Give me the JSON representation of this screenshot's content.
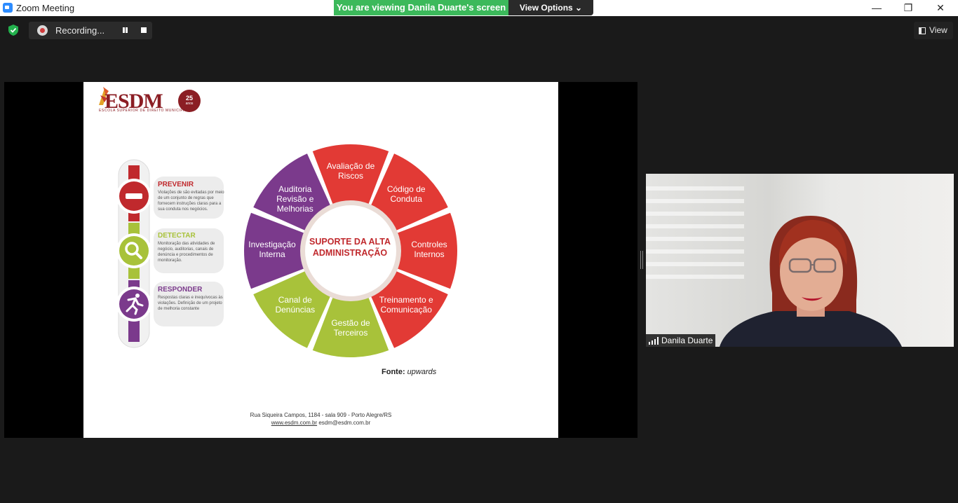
{
  "window": {
    "title": "Zoom Meeting",
    "minimize": "—",
    "restore": "❐",
    "close": "✕"
  },
  "share_banner": {
    "text": "You are viewing Danila Duarte's screen",
    "view_options": "View Options ⌄"
  },
  "toolbar": {
    "recording_label": "Recording...",
    "view_label": "View"
  },
  "slide": {
    "logo_text": "ESDM",
    "logo_sub": "ESCOLA SUPERIOR DE DIREITO MUNICIPAL",
    "badge_num": "25",
    "badge_anos": "anos",
    "stages": [
      {
        "title": "PREVENIR",
        "color": "#c0292d",
        "desc": "Violações de são evitadas por meio de um conjunto de regras que fornecem instruções claras para a sua conduta nos negócios."
      },
      {
        "title": "DETECTAR",
        "color": "#a8c23a",
        "desc": "Monitoração das atividades de negócio, auditorias, canais de denúncia e procedimentos de monitoração."
      },
      {
        "title": "RESPONDER",
        "color": "#7b3a8c",
        "desc": "Respostas claras e inequívocas às violações. Definição de um projeto de melhoria constante"
      }
    ],
    "wheel": {
      "center": "SUPORTE DA ALTA ADMINISTRAÇÃO",
      "segments": [
        {
          "label": "Avaliação de Riscos",
          "color": "#e23a35"
        },
        {
          "label": "Código de Conduta",
          "color": "#e23a35"
        },
        {
          "label": "Controles Internos",
          "color": "#e23a35"
        },
        {
          "label": "Treinamento e Comunicação",
          "color": "#e23a35"
        },
        {
          "label": "Gestão de Terceiros",
          "color": "#a8c23a"
        },
        {
          "label": "Canal de Denúncias",
          "color": "#a8c23a"
        },
        {
          "label": "Investigação Interna",
          "color": "#7b3a8c"
        },
        {
          "label": "Auditoria Revisão e Melhorias",
          "color": "#7b3a8c"
        }
      ]
    },
    "fonte_label": "Fonte:",
    "fonte_value": "upwards",
    "footer_address": "Rua Siqueira Campos, 1184 - sala 909 - Porto Alegre/RS",
    "footer_web": "www.esdm.com.br",
    "footer_email": "esdm@esdm.com.br"
  },
  "participant": {
    "name": "Danila Duarte"
  }
}
